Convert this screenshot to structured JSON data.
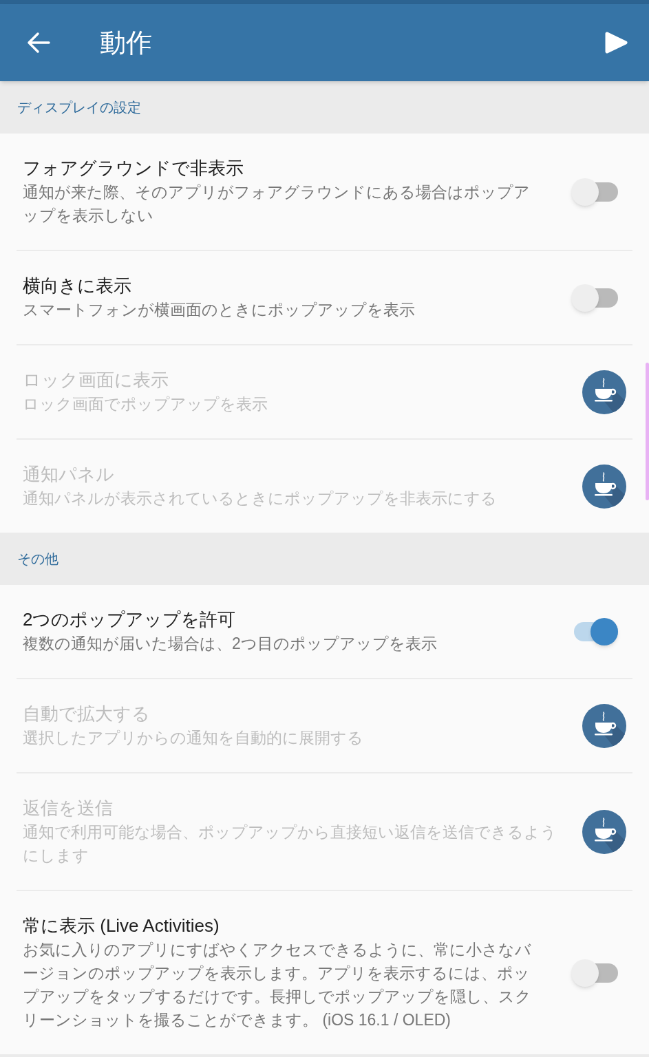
{
  "app_bar": {
    "title": "動作"
  },
  "sections": [
    {
      "header": "ディスプレイの設定",
      "items": [
        {
          "kind": "switch",
          "title": "フォアグラウンドで非表示",
          "description": "通知が来た際、そのアプリがフォアグラウンドにある場合はポップアップを表示しない",
          "on": false,
          "disabled": false
        },
        {
          "kind": "switch",
          "title": "横向きに表示",
          "description": "スマートフォンが横画面のときにポップアップを表示",
          "on": false,
          "disabled": false
        },
        {
          "kind": "premium",
          "title": "ロック画面に表示",
          "description": "ロック画面でポップアップを表示",
          "disabled": true
        },
        {
          "kind": "premium",
          "title": "通知パネル",
          "description": "通知パネルが表示されているときにポップアップを非表示にする",
          "disabled": true
        }
      ]
    },
    {
      "header": "その他",
      "items": [
        {
          "kind": "switch",
          "title": "2つのポップアップを許可",
          "description": "複数の通知が届いた場合は、2つ目のポップアップを表示",
          "on": true,
          "disabled": false
        },
        {
          "kind": "premium",
          "title": "自動で拡大する",
          "description": "選択したアプリからの通知を自動的に展開する",
          "disabled": true
        },
        {
          "kind": "premium",
          "title": "返信を送信",
          "description": "通知で利用可能な場合、ポップアップから直接短い返信を送信できるようにします",
          "disabled": true
        },
        {
          "kind": "switch",
          "title": "常に表示 (Live Activities)",
          "description": "お気に入りのアプリにすばやくアクセスできるように、常に小さなバージョンのポップアップを表示します。アプリを表示するには、ポップアップをタップするだけです。長押しでポップアップを隠し、スクリーンショットを撮ることができます。 (iOS 16.1 / OLED)",
          "on": false,
          "disabled": false
        }
      ]
    }
  ]
}
